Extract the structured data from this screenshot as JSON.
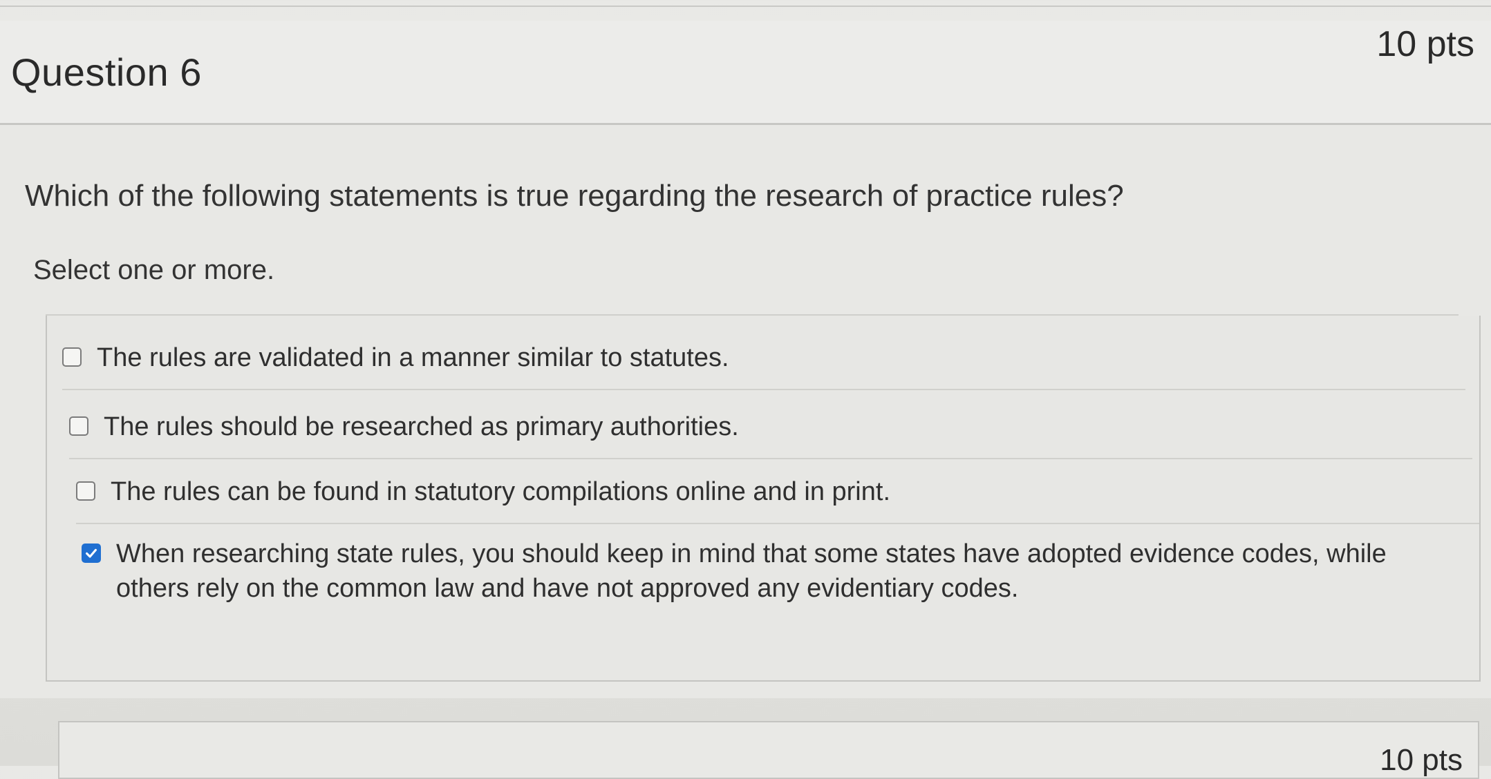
{
  "question": {
    "title": "Question 6",
    "points": "10 pts",
    "text": "Which of the following statements is true regarding the research of practice rules?",
    "instructions": "Select one or more.",
    "answers": [
      {
        "label": "The rules are validated in a manner similar to statutes.",
        "checked": false
      },
      {
        "label": "The rules should be researched as primary authorities.",
        "checked": false
      },
      {
        "label": "The rules can be found in statutory compilations online and in print.",
        "checked": false
      },
      {
        "label": "When researching state rules, you should keep in mind that some states have adopted evidence codes, while others rely on the common law and have not approved any evidentiary codes.",
        "checked": true
      }
    ]
  },
  "next_question": {
    "points": "10 pts"
  },
  "colors": {
    "checkbox_checked": "#1f6fd1",
    "text": "#2f2f2f"
  }
}
